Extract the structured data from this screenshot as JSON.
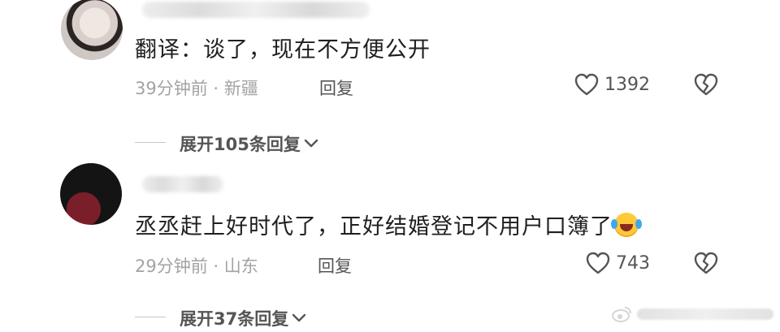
{
  "comments": [
    {
      "text": "翻译：谈了，现在不方便公开",
      "time": "39分钟前",
      "location": "新疆",
      "reply_label": "回复",
      "likes": "1392",
      "expand_label": "展开105条回复"
    },
    {
      "text": "丞丞赶上好时代了，正好结婚登记不用户口簿了",
      "emoji": "rolling-on-floor-laughing",
      "time": "29分钟前",
      "location": "山东",
      "reply_label": "回复",
      "likes": "743",
      "expand_label": "展开37条回复"
    }
  ],
  "meta_separator": "·",
  "icons": {
    "like": "heart-outline-icon",
    "dislike": "broken-heart-icon",
    "expand": "chevron-down-icon"
  },
  "colors": {
    "text": "#1f1f1f",
    "meta": "#a3a3a3",
    "secondary": "#555555"
  }
}
